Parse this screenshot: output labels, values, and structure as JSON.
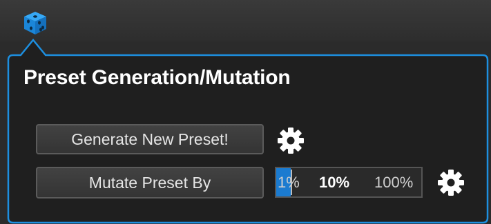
{
  "toolbar": {
    "dice_icon": "dice-icon",
    "dice_color": "#1d8fe0"
  },
  "panel": {
    "title": "Preset Generation/Mutation",
    "border_color": "#1d8fe0",
    "generate_button_label": "Generate New Preset!",
    "mutate_button_label": "Mutate Preset By",
    "gear_icon": "gear-icon",
    "mutation_slider": {
      "options": [
        "1%",
        "10%",
        "100%"
      ],
      "selected": "10%",
      "fill_fraction": 0.1,
      "fill_color": "#1b7bd0"
    }
  }
}
